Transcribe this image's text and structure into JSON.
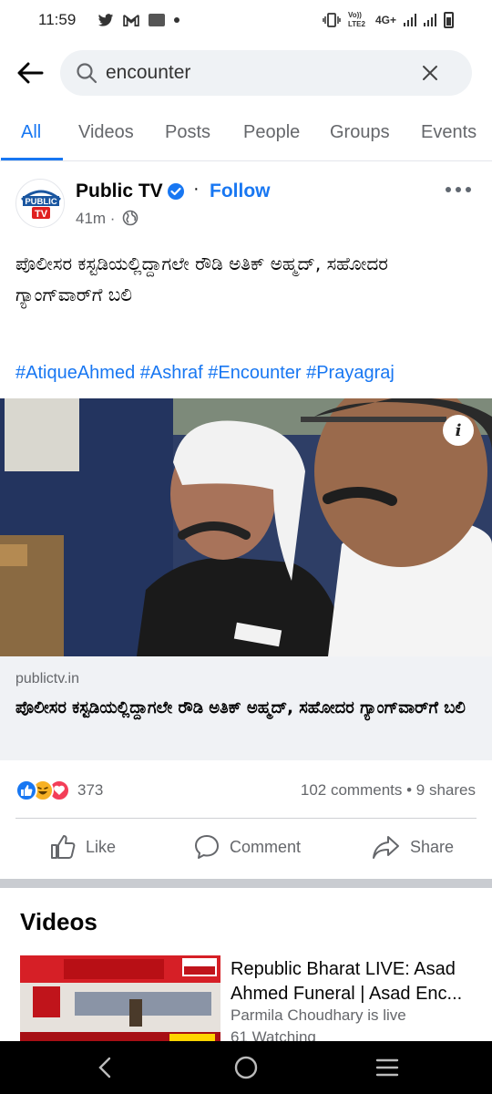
{
  "status_bar": {
    "time": "11:59",
    "network_label_top": "Vo)) LTE2",
    "network_type": "4G+",
    "icons": [
      "twitter-icon",
      "gmail-icon",
      "paytm-icon",
      "notification-dot-icon",
      "vibrate-icon",
      "signal-icon",
      "battery-icon"
    ]
  },
  "search": {
    "query": "encounter",
    "placeholder": "Search"
  },
  "tabs": [
    {
      "label": "All",
      "active": true
    },
    {
      "label": "Videos",
      "active": false
    },
    {
      "label": "Posts",
      "active": false
    },
    {
      "label": "People",
      "active": false
    },
    {
      "label": "Groups",
      "active": false
    },
    {
      "label": "Events",
      "active": false
    }
  ],
  "post": {
    "page_name": "Public TV",
    "avatar_text": [
      "PUBLIC",
      "TV"
    ],
    "separator": "·",
    "follow_label": "Follow",
    "time": "41m ·",
    "text": "ಪೊಲೀಸರ ಕಸ್ಟಡಿಯಲ್ಲಿದ್ದಾಗಲೇ ರೌಡಿ ಅತಿಕ್ ಅಹ್ಮದ್, ಸಹೋದರ ಗ್ಯಾಂಗ್‌ವಾರ್‌ಗೆ ಬಲಿ",
    "hashtags": "#AtiqueAhmed #Ashraf #Encounter #Prayagraj",
    "info_label": "i",
    "link": {
      "domain": "publictv.in",
      "title": "ಪೊಲೀಸರ ಕಸ್ಟಡಿಯಲ್ಲಿದ್ದಾಗಲೇ ರೌಡಿ ಅತಿಕ್ ಅಹ್ಮದ್, ಸಹೋದರ ಗ್ಯಾಂಗ್‌ವಾರ್‌ಗೆ ಬಲಿ"
    },
    "reaction_count": "373",
    "engagement": "102 comments • 9 shares",
    "actions": {
      "like": "Like",
      "comment": "Comment",
      "share": "Share"
    }
  },
  "videos": {
    "title": "Videos",
    "item": {
      "title_line1": "Republic Bharat LIVE: Asad",
      "title_line2": "Ahmed Funeral | Asad Enc...",
      "channel": "Parmila Choudhary is live",
      "watching": "61 Watching"
    }
  },
  "colors": {
    "accent": "#1877f2",
    "text_secondary": "#65676b",
    "link_bg": "#f0f2f5"
  }
}
